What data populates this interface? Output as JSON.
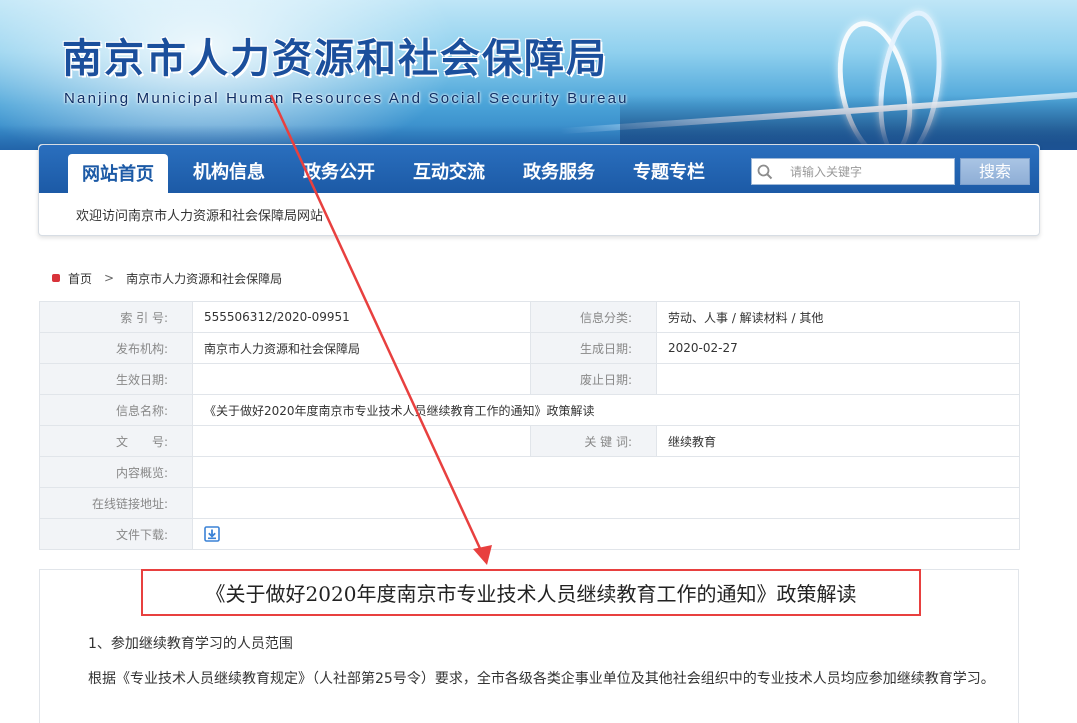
{
  "header": {
    "title": "南京市人力资源和社会保障局",
    "subtitle": "Nanjing  Municipal  Human  Resources  And  Social  Security  Bureau"
  },
  "nav": {
    "items": [
      {
        "label": "网站首页",
        "active": true
      },
      {
        "label": "机构信息",
        "active": false
      },
      {
        "label": "政务公开",
        "active": false
      },
      {
        "label": "互动交流",
        "active": false
      },
      {
        "label": "政务服务",
        "active": false
      },
      {
        "label": "专题专栏",
        "active": false
      }
    ],
    "search": {
      "placeholder": "请输入关键字",
      "button_label": "搜索"
    },
    "welcome": "欢迎访问南京市人力资源和社会保障局网站"
  },
  "breadcrumb": {
    "home": "首页",
    "separator": ">",
    "current": "南京市人力资源和社会保障局"
  },
  "info": {
    "index_label": "索 引 号:",
    "index_value": "555506312/2020-09951",
    "category_label": "信息分类:",
    "category_value": "劳动、人事 / 解读材料 / 其他",
    "publisher_label": "发布机构:",
    "publisher_value": "南京市人力资源和社会保障局",
    "created_label": "生成日期:",
    "created_value": "2020-02-27",
    "effective_label": "生效日期:",
    "effective_value": "",
    "expired_label": "废止日期:",
    "expired_value": "",
    "name_label": "信息名称:",
    "name_value": "《关于做好2020年度南京市专业技术人员继续教育工作的通知》政策解读",
    "doc_no_label": "文　　号:",
    "doc_no_value": "",
    "keywords_label": "关 键 词:",
    "keywords_value": "继续教育",
    "summary_label": "内容概览:",
    "summary_value": "",
    "link_label": "在线链接地址:",
    "link_value": "",
    "download_label": "文件下载:"
  },
  "article": {
    "title": "《关于做好2020年度南京市专业技术人员继续教育工作的通知》政策解读",
    "section_heading": "1、参加继续教育学习的人员范围",
    "paragraph": "根据《专业技术人员继续教育规定》（人社部第25号令）要求，全市各级各类企事业单位及其他社会组织中的专业技术人员均应参加继续教育学习。"
  },
  "colors": {
    "nav_blue": "#1c5aa6",
    "annotation_red": "#e8403f",
    "label_bg": "#f2f4f7"
  },
  "icons": [
    "search-icon",
    "home-icon",
    "download-icon"
  ]
}
